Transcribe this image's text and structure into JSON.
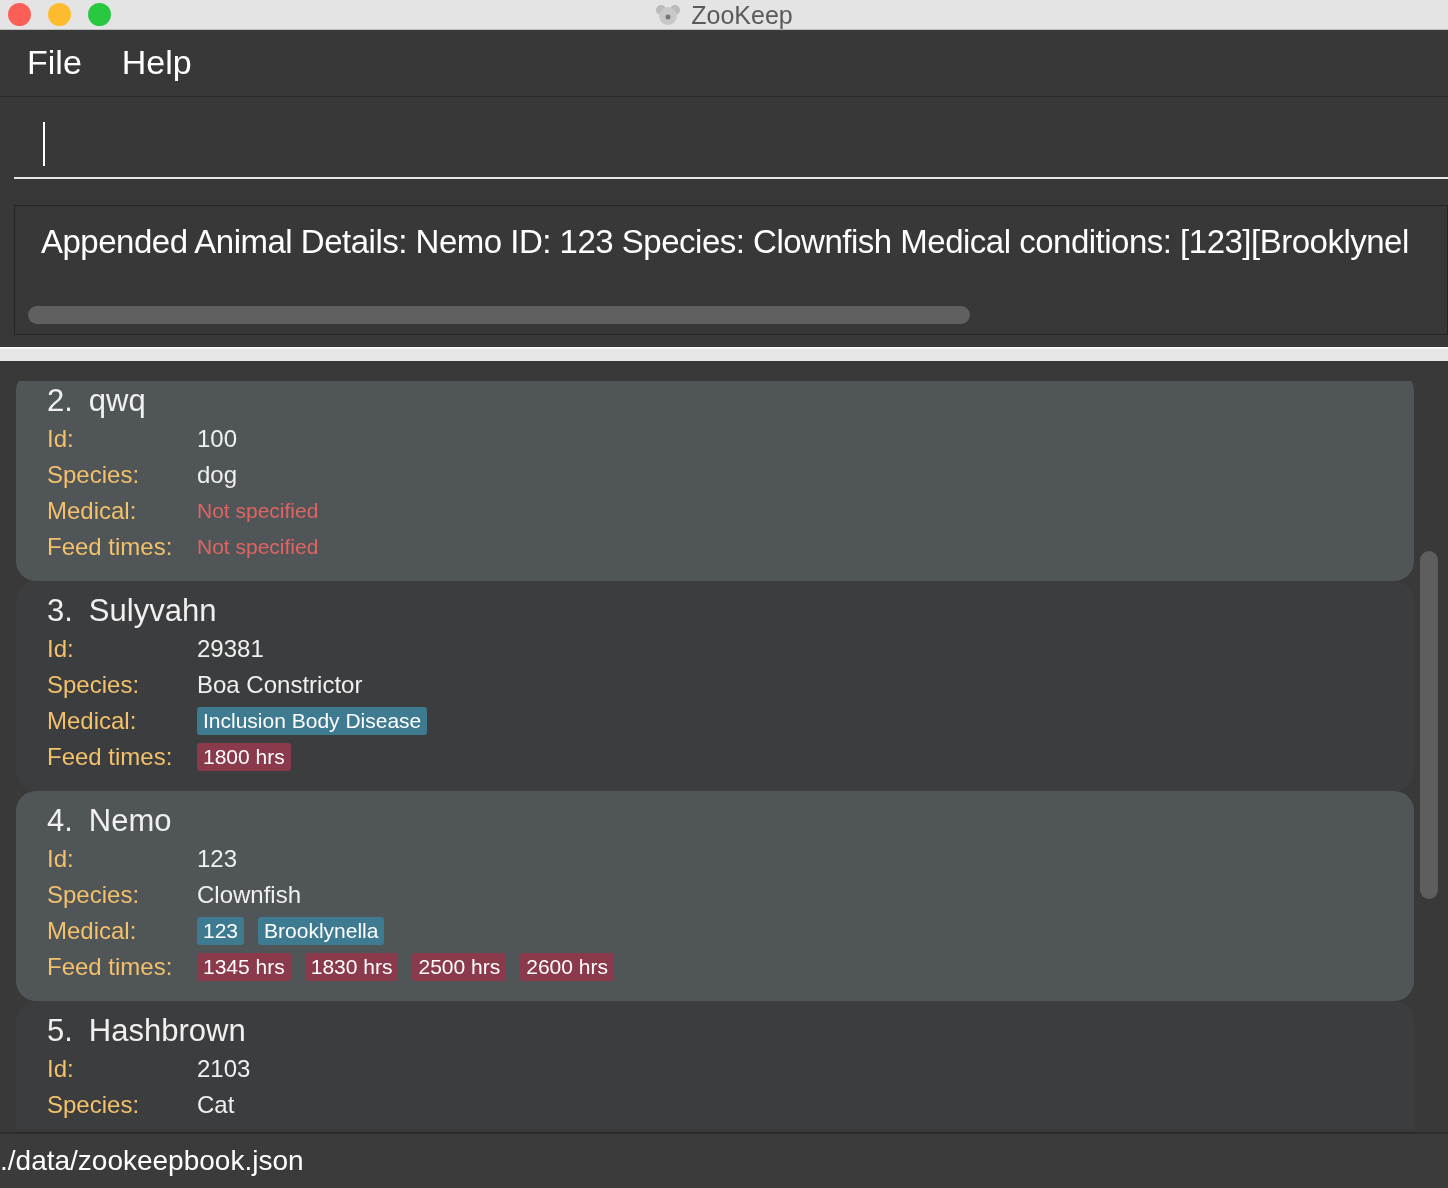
{
  "window": {
    "title": "ZooKeep"
  },
  "menu": [
    "File",
    "Help"
  ],
  "result_display": {
    "text": "Appended Animal Details: Nemo ID: 123 Species: Clownfish Medical conditions: [123][Brooklynel"
  },
  "animals": [
    {
      "index": "2.",
      "name": "qwq",
      "fields": [
        {
          "label": "Id:",
          "kind": "text",
          "value": "100"
        },
        {
          "label": "Species:",
          "kind": "text",
          "value": "dog"
        },
        {
          "label": "Medical:",
          "kind": "empty",
          "value": "Not specified"
        },
        {
          "label": "Feed times:",
          "kind": "empty",
          "value": "Not specified"
        }
      ]
    },
    {
      "index": "3.",
      "name": "Sulyvahn",
      "fields": [
        {
          "label": "Id:",
          "kind": "text",
          "value": "29381"
        },
        {
          "label": "Species:",
          "kind": "text",
          "value": "Boa Constrictor"
        },
        {
          "label": "Medical:",
          "kind": "medical",
          "tags": [
            "Inclusion Body Disease"
          ]
        },
        {
          "label": "Feed times:",
          "kind": "feed",
          "tags": [
            "1800 hrs"
          ]
        }
      ]
    },
    {
      "index": "4.",
      "name": "Nemo",
      "fields": [
        {
          "label": "Id:",
          "kind": "text",
          "value": "123"
        },
        {
          "label": "Species:",
          "kind": "text",
          "value": "Clownfish"
        },
        {
          "label": "Medical:",
          "kind": "medical",
          "tags": [
            "123",
            "Brooklynella"
          ]
        },
        {
          "label": "Feed times:",
          "kind": "feed",
          "tags": [
            "1345 hrs",
            "1830 hrs",
            "2500 hrs",
            "2600 hrs"
          ]
        }
      ]
    },
    {
      "index": "5.",
      "name": "Hashbrown",
      "fields": [
        {
          "label": "Id:",
          "kind": "text",
          "value": "2103"
        },
        {
          "label": "Species:",
          "kind": "text",
          "value": "Cat"
        }
      ]
    }
  ],
  "status_bar": {
    "path": "./data/zookeepbook.json"
  }
}
